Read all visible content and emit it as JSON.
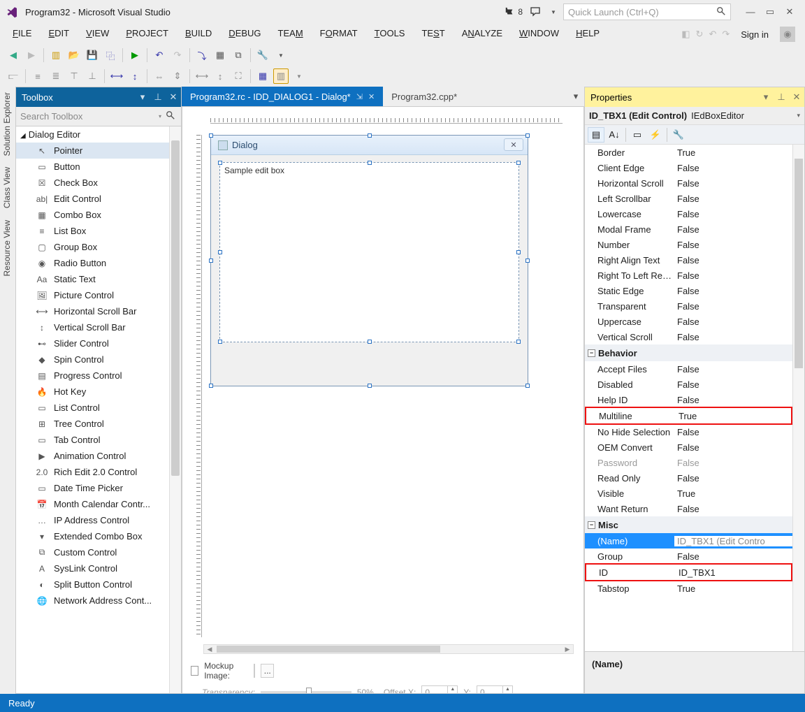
{
  "title": "Program32 - Microsoft Visual Studio",
  "notification_count": "8",
  "quick_launch_placeholder": "Quick Launch (Ctrl+Q)",
  "sign_in": "Sign in",
  "menu": [
    "FILE",
    "EDIT",
    "VIEW",
    "PROJECT",
    "BUILD",
    "DEBUG",
    "TEAM",
    "FORMAT",
    "TOOLS",
    "TEST",
    "ANALYZE",
    "WINDOW",
    "HELP"
  ],
  "side_tabs": [
    "Solution Explorer",
    "Class View",
    "Resource View"
  ],
  "toolbox": {
    "title": "Toolbox",
    "search_placeholder": "Search Toolbox",
    "group": "Dialog Editor",
    "items": [
      "Pointer",
      "Button",
      "Check Box",
      "Edit Control",
      "Combo Box",
      "List Box",
      "Group Box",
      "Radio Button",
      "Static Text",
      "Picture Control",
      "Horizontal Scroll Bar",
      "Vertical Scroll Bar",
      "Slider Control",
      "Spin Control",
      "Progress Control",
      "Hot Key",
      "List Control",
      "Tree Control",
      "Tab Control",
      "Animation Control",
      "Rich Edit 2.0 Control",
      "Date Time Picker",
      "Month Calendar Contr...",
      "IP Address Control",
      "Extended Combo Box",
      "Custom Control",
      "SysLink Control",
      "Split Button Control",
      "Network Address Cont..."
    ]
  },
  "tabs": {
    "active": "Program32.rc - IDD_DIALOG1 - Dialog*",
    "inactive": "Program32.cpp*"
  },
  "dialog": {
    "title": "Dialog",
    "edit_text": "Sample edit box"
  },
  "mockup": {
    "label": "Mockup Image:",
    "transparency_label": "Transparency:",
    "transparency_value": "50%",
    "offset_x_label": "Offset X:",
    "offset_x": "0",
    "offset_y_label": "Y:",
    "offset_y": "0",
    "browse": "..."
  },
  "properties": {
    "title": "Properties",
    "selector_bold": "ID_TBX1 (Edit Control)",
    "selector_rest": "IEdBoxEditor",
    "desc": "(Name)",
    "appearance": [
      {
        "n": "Border",
        "v": "True"
      },
      {
        "n": "Client Edge",
        "v": "False"
      },
      {
        "n": "Horizontal Scroll",
        "v": "False"
      },
      {
        "n": "Left Scrollbar",
        "v": "False"
      },
      {
        "n": "Lowercase",
        "v": "False"
      },
      {
        "n": "Modal Frame",
        "v": "False"
      },
      {
        "n": "Number",
        "v": "False"
      },
      {
        "n": "Right Align Text",
        "v": "False"
      },
      {
        "n": "Right To Left Readi",
        "v": "False"
      },
      {
        "n": "Static Edge",
        "v": "False"
      },
      {
        "n": "Transparent",
        "v": "False"
      },
      {
        "n": "Uppercase",
        "v": "False"
      },
      {
        "n": "Vertical Scroll",
        "v": "False"
      }
    ],
    "behavior_label": "Behavior",
    "behavior": [
      {
        "n": "Accept Files",
        "v": "False"
      },
      {
        "n": "Disabled",
        "v": "False"
      },
      {
        "n": "Help ID",
        "v": "False"
      },
      {
        "n": "Multiline",
        "v": "True",
        "hl": true
      },
      {
        "n": "No Hide Selection",
        "v": "False"
      },
      {
        "n": "OEM Convert",
        "v": "False"
      },
      {
        "n": "Password",
        "v": "False",
        "dis": true
      },
      {
        "n": "Read Only",
        "v": "False"
      },
      {
        "n": "Visible",
        "v": "True"
      },
      {
        "n": "Want Return",
        "v": "False"
      }
    ],
    "misc_label": "Misc",
    "misc": [
      {
        "n": "(Name)",
        "v": "ID_TBX1 (Edit Contro",
        "sel": true
      },
      {
        "n": "Group",
        "v": "False"
      },
      {
        "n": "ID",
        "v": "ID_TBX1",
        "hl": true
      },
      {
        "n": "Tabstop",
        "v": "True"
      }
    ]
  },
  "status": "Ready"
}
